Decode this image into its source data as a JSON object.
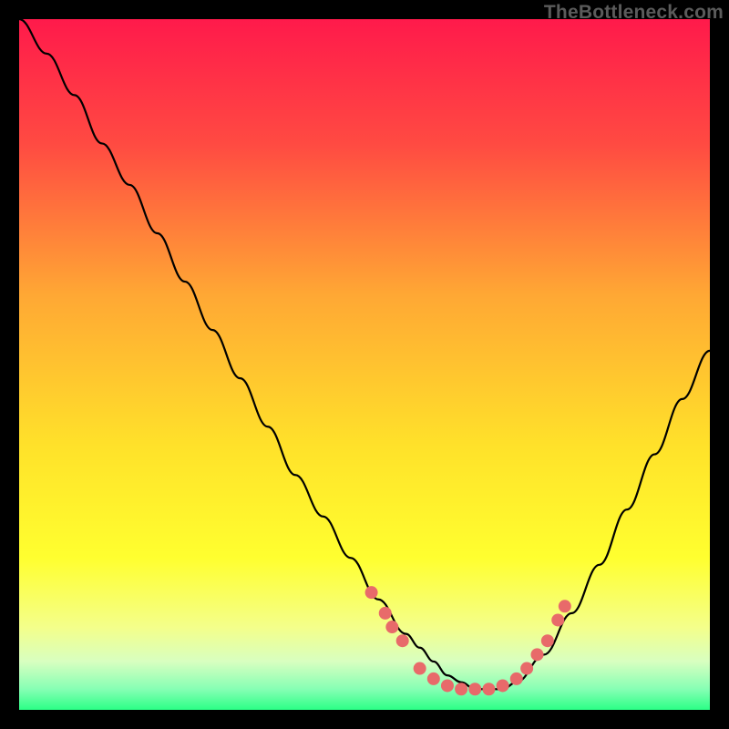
{
  "watermark": {
    "text": "TheBottleneck.com"
  },
  "chart_data": {
    "type": "line",
    "title": "",
    "xlabel": "",
    "ylabel": "",
    "xlim": [
      0,
      100
    ],
    "ylim": [
      0,
      100
    ],
    "grid": false,
    "legend": false,
    "gradient_stops": [
      {
        "offset": 0.0,
        "color": "#ff1a4b"
      },
      {
        "offset": 0.18,
        "color": "#ff4a42"
      },
      {
        "offset": 0.4,
        "color": "#ffa834"
      },
      {
        "offset": 0.62,
        "color": "#ffe22a"
      },
      {
        "offset": 0.78,
        "color": "#ffff2f"
      },
      {
        "offset": 0.88,
        "color": "#f4ff8a"
      },
      {
        "offset": 0.93,
        "color": "#d8ffc0"
      },
      {
        "offset": 0.97,
        "color": "#86ffb4"
      },
      {
        "offset": 1.0,
        "color": "#2bff86"
      }
    ],
    "series": [
      {
        "name": "bottleneck-curve",
        "x": [
          0,
          4,
          8,
          12,
          16,
          20,
          24,
          28,
          32,
          36,
          40,
          44,
          48,
          52,
          56,
          58,
          60,
          62,
          64,
          66,
          68,
          70,
          72,
          76,
          80,
          84,
          88,
          92,
          96,
          100
        ],
        "y": [
          100,
          95,
          89,
          82,
          76,
          69,
          62,
          55,
          48,
          41,
          34,
          28,
          22,
          16,
          11,
          9,
          7,
          5,
          4,
          3,
          3,
          3,
          4,
          8,
          14,
          21,
          29,
          37,
          45,
          52
        ]
      }
    ],
    "highlight_points": {
      "name": "sweet-spot-markers",
      "color": "#e86a6a",
      "radius": 7,
      "points": [
        {
          "x": 51,
          "y": 17
        },
        {
          "x": 53,
          "y": 14
        },
        {
          "x": 54,
          "y": 12
        },
        {
          "x": 55.5,
          "y": 10
        },
        {
          "x": 58,
          "y": 6
        },
        {
          "x": 60,
          "y": 4.5
        },
        {
          "x": 62,
          "y": 3.5
        },
        {
          "x": 64,
          "y": 3
        },
        {
          "x": 66,
          "y": 3
        },
        {
          "x": 68,
          "y": 3
        },
        {
          "x": 70,
          "y": 3.5
        },
        {
          "x": 72,
          "y": 4.5
        },
        {
          "x": 73.5,
          "y": 6
        },
        {
          "x": 75,
          "y": 8
        },
        {
          "x": 76.5,
          "y": 10
        },
        {
          "x": 78,
          "y": 13
        },
        {
          "x": 79,
          "y": 15
        }
      ]
    }
  }
}
